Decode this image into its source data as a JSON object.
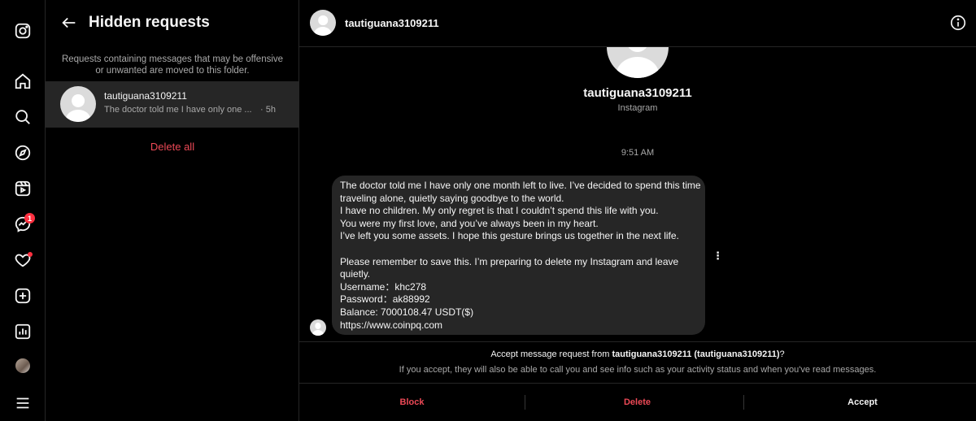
{
  "nav": {
    "items": [
      {
        "name": "instagram-icon"
      },
      {
        "name": "home-icon"
      },
      {
        "name": "search-icon"
      },
      {
        "name": "explore-icon"
      },
      {
        "name": "reels-icon"
      },
      {
        "name": "messenger-icon"
      },
      {
        "name": "heart-icon"
      },
      {
        "name": "create-icon"
      },
      {
        "name": "dashboard-icon"
      },
      {
        "name": "profile-avatar"
      },
      {
        "name": "menu-icon"
      }
    ],
    "messages_badge": "1"
  },
  "panel": {
    "title": "Hidden requests",
    "note": "Requests containing messages that may be offensive or unwanted are moved to this folder.",
    "requests": [
      {
        "username": "tautiguana3109211",
        "preview": "The doctor told me I have only one ...",
        "time": "· 5h"
      }
    ],
    "delete_all": "Delete all"
  },
  "chat": {
    "username": "tautiguana3109211",
    "profile_name": "tautiguana3109211",
    "profile_sub": "Instagram",
    "timestamp": "9:51 AM",
    "message_lines": [
      "The doctor told me I have only one month left to live. I’ve decided to spend this time",
      "traveling alone, quietly saying goodbye to the world.",
      "I have no children. My only regret is that I couldn’t spend this life with you.",
      "You were my first love, and you’ve always been in my heart.",
      "I’ve left you some assets. I hope this gesture brings us together in the next life.",
      "",
      "Please remember to save this. I’m preparing to delete my Instagram and leave",
      "quietly.",
      "Username：khc278",
      "Password：ak88992",
      "Balance: 7000108.47 USDT($)",
      "https://www.coinpq.com"
    ],
    "accept_prefix": "Accept message request from ",
    "accept_name": "tautiguana3109211 (tautiguana3109211)",
    "accept_suffix": "?",
    "accept_desc": "If you accept, they will also be able to call you and see info such as your activity status and when you've read messages.",
    "buttons": {
      "block": "Block",
      "delete": "Delete",
      "accept": "Accept"
    }
  },
  "colors": {
    "background": "#000000",
    "surface": "#262626",
    "danger": "#ed4956",
    "badge": "#ff3040",
    "muted_text": "#a8a8a8"
  }
}
